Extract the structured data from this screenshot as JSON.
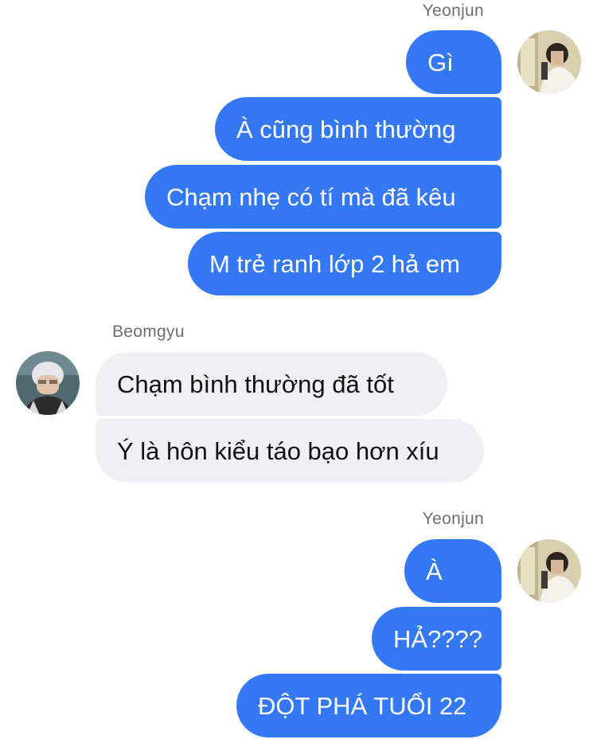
{
  "groups": [
    {
      "sender": "Yeonjun",
      "direction": "outgoing",
      "messages": [
        "Gì",
        "À cũng bình thường",
        "Chạm nhẹ có tí mà đã kêu",
        "M trẻ ranh lớp 2 hả em"
      ]
    },
    {
      "sender": "Beomgyu",
      "direction": "incoming",
      "messages": [
        "Chạm bình thường đã tốt",
        "Ý là hôn kiểu táo bạo hơn xíu"
      ]
    },
    {
      "sender": "Yeonjun",
      "direction": "outgoing",
      "messages": [
        "À",
        "HẢ????",
        "ĐỘT PHÁ TUỔI 22"
      ]
    }
  ],
  "colors": {
    "outgoing_bubble": "#3478f6",
    "incoming_bubble": "#f0f0f4",
    "sender_name": "#6d6d72"
  }
}
